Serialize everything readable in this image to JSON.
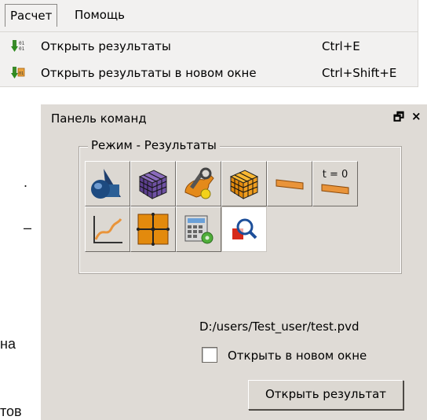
{
  "menubar": {
    "active_menu": "Расчет",
    "help_menu": "Помощь",
    "items": [
      {
        "label": "Открыть результаты",
        "shortcut": "Ctrl+E",
        "icon": "binary-green-arrow-icon"
      },
      {
        "label": "Открыть результаты в новом окне",
        "shortcut": "Ctrl+Shift+E",
        "icon": "binary-window-arrow-icon"
      }
    ]
  },
  "background_fragments": {
    "dot": ".",
    "dash": "–",
    "na": "на",
    "tov": "тов"
  },
  "panel": {
    "title": "Панель команд",
    "float_glyph": "🗗",
    "close_glyph": "×",
    "group_title": "Режим - Результаты",
    "toolbar_buttons": [
      {
        "name": "geometry-icon"
      },
      {
        "name": "mesh-cube-icon"
      },
      {
        "name": "settings-wrench-icon"
      },
      {
        "name": "results-cube-icon"
      },
      {
        "name": "beam-icon"
      },
      {
        "name": "initial-state-icon",
        "label": "t = 0"
      },
      {
        "name": "graph-plot-icon"
      },
      {
        "name": "grid-plane-icon"
      },
      {
        "name": "calculator-settings-icon"
      },
      {
        "name": "magnifier-results-icon",
        "pressed": true
      }
    ],
    "file_path": "D:/users/Test_user/test.pvd",
    "checkbox_label": "Открыть в новом окне",
    "checkbox_checked": false,
    "open_button_label": "Открыть результат"
  }
}
